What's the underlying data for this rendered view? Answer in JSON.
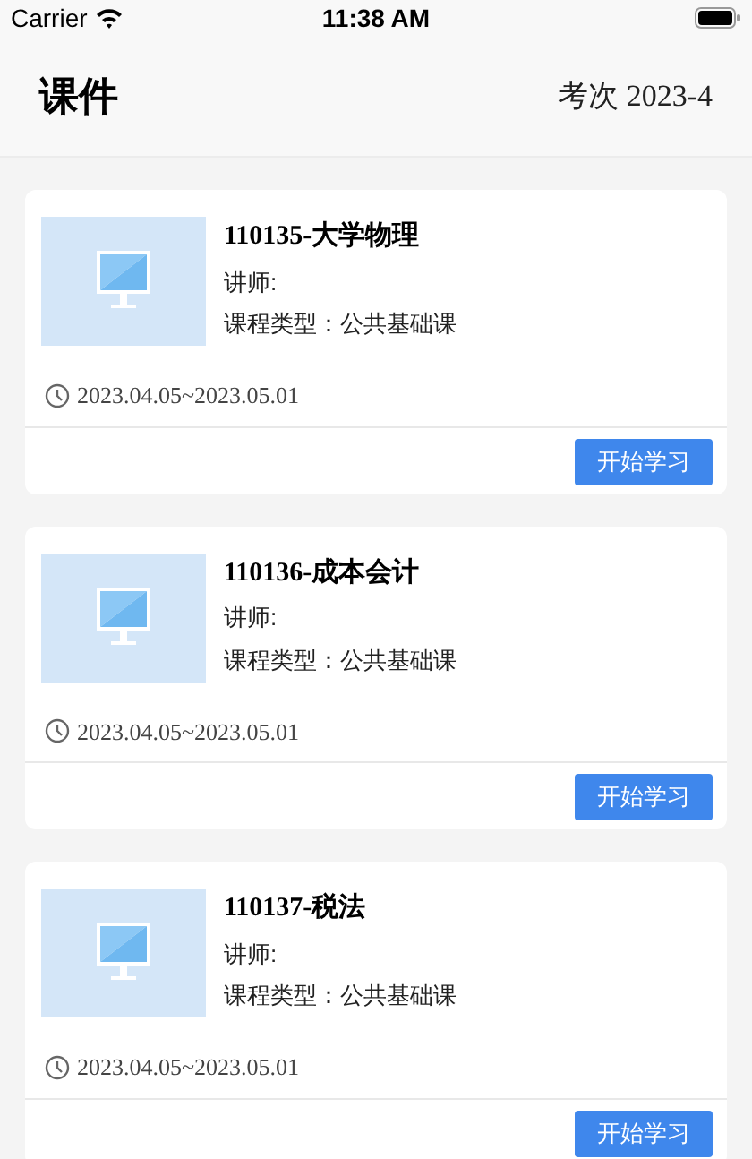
{
  "status_bar": {
    "carrier": "Carrier",
    "time": "11:38 AM"
  },
  "header": {
    "title": "课件",
    "exam": "考次 2023-4"
  },
  "courses": [
    {
      "title": "110135-大学物理",
      "teacher": "讲师:",
      "type": "课程类型：公共基础课",
      "period": "2023.04.05~2023.05.01",
      "button": "开始学习"
    },
    {
      "title": "110136-成本会计",
      "teacher": "讲师:",
      "type": "课程类型：公共基础课",
      "period": "2023.04.05~2023.05.01",
      "button": "开始学习"
    },
    {
      "title": "110137-税法",
      "teacher": "讲师:",
      "type": "课程类型：公共基础课",
      "period": "2023.04.05~2023.05.01",
      "button": "开始学习"
    }
  ]
}
